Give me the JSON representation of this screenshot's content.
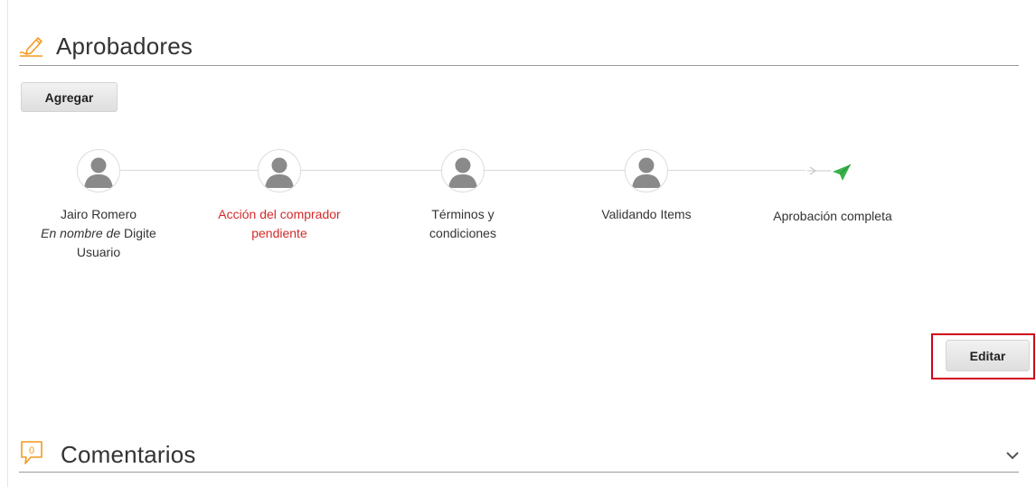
{
  "approvers": {
    "title": "Aprobadores",
    "header_icon": "pen-signature-icon",
    "add_button": "Agregar",
    "steps": [
      {
        "lines": [
          "Jairo Romero",
          "Digite",
          "Usuario"
        ],
        "on_behalf_prefix": "En nombre de",
        "status": "normal",
        "icon": "user-avatar-icon"
      },
      {
        "lines": [
          "Acción del comprador",
          "pendiente"
        ],
        "status": "pending",
        "icon": "user-avatar-icon"
      },
      {
        "lines": [
          "Términos y",
          "condiciones"
        ],
        "status": "normal",
        "icon": "user-avatar-icon"
      },
      {
        "lines": [
          "Validando Items"
        ],
        "status": "normal",
        "icon": "user-avatar-icon"
      }
    ],
    "final": {
      "label": "Aprobación completa",
      "icon": "paper-plane-icon"
    },
    "edit_button": "Editar"
  },
  "comments": {
    "title": "Comentarios",
    "count": "0",
    "header_icon": "speech-bubble-icon",
    "expand_icon": "chevron-down-icon"
  },
  "colors": {
    "pending_text": "#d42a2a",
    "highlight_border": "#d0001b",
    "brand_orange": "#f39a1e",
    "final_green": "#37b34a"
  }
}
